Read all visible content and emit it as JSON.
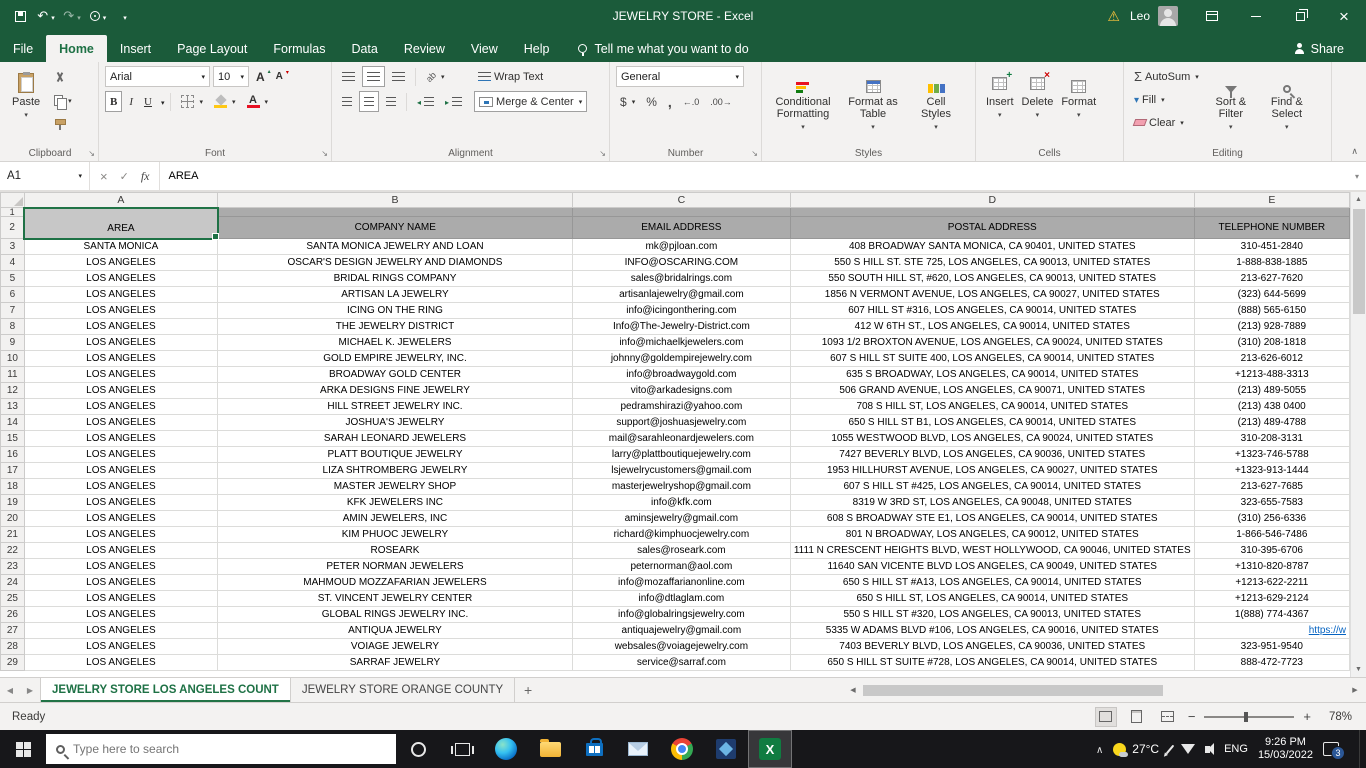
{
  "title_bar": {
    "title": "JEWELRY STORE  -  Excel",
    "user_name": "Leo"
  },
  "ribbon_tabs": {
    "file": "File",
    "tabs": [
      "Home",
      "Insert",
      "Page Layout",
      "Formulas",
      "Data",
      "Review",
      "View",
      "Help"
    ],
    "tell_me": "Tell me what you want to do",
    "share": "Share"
  },
  "ribbon": {
    "clipboard": {
      "label": "Clipboard",
      "paste": "Paste"
    },
    "font": {
      "label": "Font",
      "name": "Arial",
      "size": "10",
      "bold": "B",
      "italic": "I",
      "underline": "U"
    },
    "alignment": {
      "label": "Alignment",
      "wrap": "Wrap Text",
      "merge": "Merge & Center"
    },
    "number": {
      "label": "Number",
      "format": "General"
    },
    "styles": {
      "label": "Styles",
      "conditional": "Conditional Formatting",
      "format_table": "Format as Table",
      "cell_styles": "Cell Styles"
    },
    "cells": {
      "label": "Cells",
      "insert": "Insert",
      "delete": "Delete",
      "format": "Format"
    },
    "editing": {
      "label": "Editing",
      "autosum": "AutoSum",
      "fill": "Fill",
      "clear": "Clear",
      "sort": "Sort & Filter",
      "find": "Find & Select"
    }
  },
  "formula_bar": {
    "name_box": "A1",
    "fx": "fx",
    "content": "AREA"
  },
  "grid": {
    "column_letters": [
      "A",
      "B",
      "C",
      "D",
      "E"
    ],
    "row1": "1",
    "row2": "2",
    "headers": {
      "area": "AREA",
      "company": "COMPANY NAME",
      "email": "EMAIL ADDRESS",
      "postal": "POSTAL ADDRESS",
      "phone": "TELEPHONE NUMBER"
    },
    "rows": [
      {
        "n": "3",
        "area": "SANTA MONICA",
        "company": "SANTA MONICA JEWELRY AND LOAN",
        "email": "mk@pjloan.com",
        "postal": "408 BROADWAY SANTA MONICA, CA 90401, UNITED STATES",
        "phone": "310-451-2840"
      },
      {
        "n": "4",
        "area": "LOS ANGELES",
        "company": "OSCAR'S DESIGN JEWELRY AND DIAMONDS",
        "email": "INFO@OSCARING.COM",
        "postal": "550 S HILL ST. STE 725, LOS ANGELES, CA 90013, UNITED STATES",
        "phone": "1-888-838-1885"
      },
      {
        "n": "5",
        "area": "LOS ANGELES",
        "company": "BRIDAL RINGS COMPANY",
        "email": "sales@bridalrings.com",
        "postal": "550 SOUTH HILL ST, #620, LOS ANGELES, CA 90013, UNITED STATES",
        "phone": "213-627-7620"
      },
      {
        "n": "6",
        "area": "LOS ANGELES",
        "company": "ARTISAN LA JEWELRY",
        "email": "artisanlajewelry@gmail.com",
        "postal": "1856 N VERMONT AVENUE, LOS ANGELES, CA 90027, UNITED STATES",
        "phone": "(323) 644-5699"
      },
      {
        "n": "7",
        "area": "LOS ANGELES",
        "company": "ICING ON THE RING",
        "email": "info@icingonthering.com",
        "postal": "607 HILL ST #316, LOS ANGELES, CA 90014, UNITED STATES",
        "phone": "(888) 565-6150"
      },
      {
        "n": "8",
        "area": "LOS ANGELES",
        "company": "THE JEWELRY DISTRICT",
        "email": "Info@The-Jewelry-District.com",
        "postal": "412 W 6TH ST., LOS ANGELES, CA 90014, UNITED STATES",
        "phone": "(213) 928-7889"
      },
      {
        "n": "9",
        "area": "LOS ANGELES",
        "company": "MICHAEL K. JEWELERS",
        "email": "info@michaelkjewelers.com",
        "postal": "1093 1/2 BROXTON AVENUE, LOS ANGELES, CA 90024, UNITED STATES",
        "phone": "(310) 208-1818"
      },
      {
        "n": "10",
        "area": "LOS ANGELES",
        "company": "GOLD EMPIRE JEWELRY, INC.",
        "email": "johnny@goldempirejewelry.com",
        "postal": "607 S HILL ST SUITE 400, LOS ANGELES, CA 90014, UNITED STATES",
        "phone": "213-626-6012"
      },
      {
        "n": "11",
        "area": "LOS ANGELES",
        "company": "BROADWAY GOLD CENTER",
        "email": "info@broadwaygold.com",
        "postal": "635 S BROADWAY, LOS ANGELES, CA 90014, UNITED STATES",
        "phone": "+1213-488-3313"
      },
      {
        "n": "12",
        "area": "LOS ANGELES",
        "company": "ARKA DESIGNS FINE JEWELRY",
        "email": "vito@arkadesigns.com",
        "postal": "506 GRAND AVENUE, LOS ANGELES, CA 90071, UNITED STATES",
        "phone": "(213) 489-5055"
      },
      {
        "n": "13",
        "area": "LOS ANGELES",
        "company": "HILL STREET JEWELRY INC.",
        "email": "pedramshirazi@yahoo.com",
        "postal": "708 S HILL ST, LOS ANGELES, CA 90014, UNITED STATES",
        "phone": "(213) 438 0400"
      },
      {
        "n": "14",
        "area": "LOS ANGELES",
        "company": "JOSHUA'S JEWELRY",
        "email": "support@joshuasjewelry.com",
        "postal": "650 S HILL ST B1, LOS ANGELES, CA 90014, UNITED STATES",
        "phone": "(213) 489-4788"
      },
      {
        "n": "15",
        "area": "LOS ANGELES",
        "company": "SARAH LEONARD JEWELERS",
        "email": "mail@sarahleonardjewelers.com",
        "postal": "1055 WESTWOOD BLVD, LOS ANGELES, CA 90024, UNITED STATES",
        "phone": "310-208-3131"
      },
      {
        "n": "16",
        "area": "LOS ANGELES",
        "company": "PLATT BOUTIQUE JEWELRY",
        "email": "larry@plattboutiquejewelry.com",
        "postal": "7427 BEVERLY BLVD, LOS ANGELES, CA 90036, UNITED STATES",
        "phone": "+1323-746-5788"
      },
      {
        "n": "17",
        "area": "LOS ANGELES",
        "company": "LIZA SHTROMBERG JEWELRY",
        "email": "lsjewelrycustomers@gmail.com",
        "postal": "1953 HILLHURST AVENUE, LOS ANGELES, CA 90027, UNITED STATES",
        "phone": "+1323-913-1444"
      },
      {
        "n": "18",
        "area": "LOS ANGELES",
        "company": "MASTER JEWELRY SHOP",
        "email": "masterjewelryshop@gmail.com",
        "postal": "607 S HILL ST #425, LOS ANGELES, CA 90014, UNITED STATES",
        "phone": "213-627-7685"
      },
      {
        "n": "19",
        "area": "LOS ANGELES",
        "company": "KFK JEWELERS INC",
        "email": "info@kfk.com",
        "postal": "8319 W 3RD ST, LOS ANGELES, CA 90048, UNITED STATES",
        "phone": "323-655-7583"
      },
      {
        "n": "20",
        "area": "LOS ANGELES",
        "company": "AMIN JEWELERS, INC",
        "email": "aminsjewelry@gmail.com",
        "postal": "608 S BROADWAY STE E1, LOS ANGELES, CA 90014, UNITED STATES",
        "phone": "(310) 256-6336"
      },
      {
        "n": "21",
        "area": "LOS ANGELES",
        "company": "KIM PHUOC JEWELRY",
        "email": "richard@kimphuocjewelry.com",
        "postal": "801 N BROADWAY, LOS ANGELES, CA 90012, UNITED STATES",
        "phone": "1-866-546-7486"
      },
      {
        "n": "22",
        "area": "LOS ANGELES",
        "company": "ROSEARK",
        "email": "sales@roseark.com",
        "postal": "1111 N CRESCENT HEIGHTS BLVD, WEST HOLLYWOOD, CA 90046, UNITED STATES",
        "phone": "310-395-6706"
      },
      {
        "n": "23",
        "area": "LOS ANGELES",
        "company": "PETER NORMAN JEWELERS",
        "email": "peternorman@aol.com",
        "postal": "11640 SAN VICENTE BLVD LOS ANGELES, CA 90049, UNITED STATES",
        "phone": "+1310-820-8787"
      },
      {
        "n": "24",
        "area": "LOS ANGELES",
        "company": "MAHMOUD MOZZAFARIAN JEWELERS",
        "email": "info@mozaffarianonline.com",
        "postal": "650 S HILL ST #A13, LOS ANGELES, CA 90014, UNITED STATES",
        "phone": "+1213-622-2211"
      },
      {
        "n": "25",
        "area": "LOS ANGELES",
        "company": "ST. VINCENT JEWELRY CENTER",
        "email": "info@dtlaglam.com",
        "postal": "650 S HILL ST, LOS ANGELES, CA 90014, UNITED STATES",
        "phone": "+1213-629-2124"
      },
      {
        "n": "26",
        "area": "LOS ANGELES",
        "company": "GLOBAL RINGS JEWELRY INC.",
        "email": "info@globalringsjewelry.com",
        "postal": "550 S HILL ST #320, LOS ANGELES, CA 90013, UNITED STATES",
        "phone": "1(888) 774-4367"
      },
      {
        "n": "27",
        "area": "LOS ANGELES",
        "company": "ANTIQUA JEWELRY",
        "email": "antiquajewelry@gmail.com",
        "postal": "5335 W ADAMS BLVD #106, LOS ANGELES, CA 90016, UNITED STATES",
        "phone": "https://w",
        "link": true
      },
      {
        "n": "28",
        "area": "LOS ANGELES",
        "company": "VOIAGE JEWELRY",
        "email": "websales@voiagejewelry.com",
        "postal": "7403 BEVERLY BLVD, LOS ANGELES, CA 90036, UNITED STATES",
        "phone": "323-951-9540"
      },
      {
        "n": "29",
        "area": "LOS ANGELES",
        "company": "SARRAF JEWELRY",
        "email": "service@sarraf.com",
        "postal": "650 S HILL ST SUITE #728, LOS ANGELES, CA 90014, UNITED STATES",
        "phone": "888-472-7723"
      }
    ]
  },
  "sheet_tabs": {
    "tabs": [
      {
        "label": "JEWELRY STORE LOS ANGELES COUNT"
      },
      {
        "label": "JEWELRY STORE ORANGE COUNTY"
      }
    ]
  },
  "status_bar": {
    "status": "Ready",
    "zoom": "78%"
  },
  "taskbar": {
    "search_placeholder": "Type here to search",
    "weather": "27°C",
    "language": "ENG",
    "time": "9:26 PM",
    "date": "15/03/2022",
    "notification_count": "3"
  }
}
